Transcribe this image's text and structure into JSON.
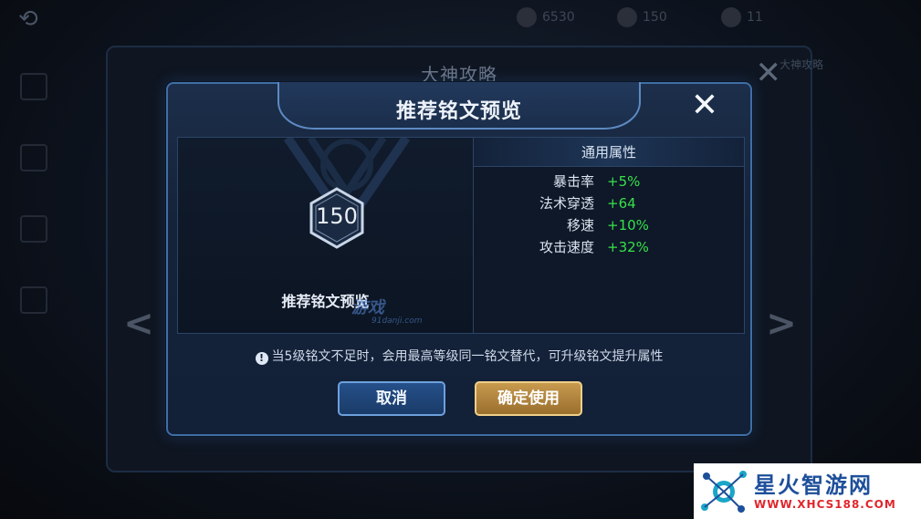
{
  "background": {
    "panel_title": "大神攻略",
    "corner_text": "大神攻略",
    "currency_1": "6530",
    "currency_2": "150",
    "currency_3": "11"
  },
  "dialog": {
    "title": "推荐铭文预览",
    "close_icon": "close-x",
    "level_badge": "150",
    "preview_label": "推荐铭文预览",
    "attributes_header": "通用属性",
    "attributes": [
      {
        "name": "暴击率",
        "value": "+5%"
      },
      {
        "name": "法术穿透",
        "value": "+64"
      },
      {
        "name": "移速",
        "value": "+10%"
      },
      {
        "name": "攻击速度",
        "value": "+32%"
      }
    ],
    "notice": "当5级铭文不足时，会用最高等级同一铭文替代，可升级铭文提升属性",
    "notice_icon": "!",
    "cancel_label": "取消",
    "confirm_label": "确定使用"
  },
  "watermark": {
    "text": "游戏",
    "sub": "91danji.com"
  },
  "brand": {
    "name": "星火智游网",
    "url": "WWW.XHCS188.COM"
  },
  "colors": {
    "attr_value": "#36e04a",
    "confirm_button": "#c79a4e",
    "cancel_button": "#25508a",
    "dialog_border": "#3f6ea6"
  }
}
